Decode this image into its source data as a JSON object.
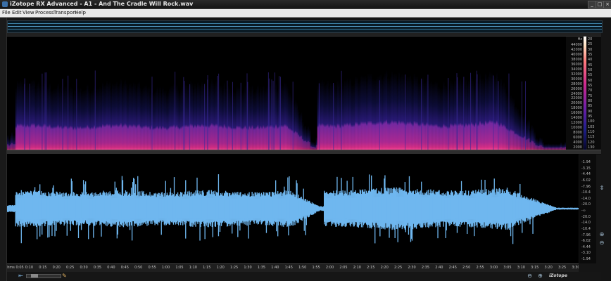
{
  "window": {
    "title": "iZotope RX Advanced - A1 - And The Cradle Will Rock.wav",
    "buttons": {
      "minimize": "_",
      "maximize": "□",
      "close": "×"
    }
  },
  "menu": [
    "File",
    "Edit",
    "View",
    "Process",
    "Transport",
    "Help"
  ],
  "spectrogram": {
    "freq_unit": "Hz",
    "freq_labels": [
      "44000",
      "42000",
      "40000",
      "38000",
      "36000",
      "34000",
      "32000",
      "30000",
      "28000",
      "26000",
      "24000",
      "22000",
      "20000",
      "18000",
      "16000",
      "14000",
      "12000",
      "10000",
      "8000",
      "6000",
      "4000",
      "2000"
    ],
    "db_labels": [
      "20",
      "25",
      "30",
      "35",
      "40",
      "45",
      "50",
      "55",
      "60",
      "65",
      "70",
      "75",
      "80",
      "85",
      "90",
      "95",
      "100",
      "105",
      "110",
      "115",
      "120",
      "130"
    ],
    "colors": {
      "background": "#000000",
      "low": "#1a1b7a",
      "mid": "#8a2aa8",
      "high": "#c42a8c",
      "peak": "#ff5aa8"
    }
  },
  "waveform": {
    "color": "#6fb7ef",
    "amp_labels": [
      "-1.94",
      "-3.15",
      "-4.44",
      "-6.02",
      "-7.96",
      "-10.4",
      "-14.0",
      "-20.0",
      "-∞",
      "-20.0",
      "-14.0",
      "-10.4",
      "-7.96",
      "-6.02",
      "-4.44",
      "-3.10",
      "-1.94"
    ]
  },
  "timeline": {
    "labels": [
      "hms 0:05",
      "0:10",
      "0:15",
      "0:20",
      "0:25",
      "0:30",
      "0:35",
      "0:40",
      "0:45",
      "0:50",
      "0:55",
      "1:00",
      "1:05",
      "1:10",
      "1:15",
      "1:20",
      "1:25",
      "1:30",
      "1:35",
      "1:40",
      "1:45",
      "1:50",
      "1:55",
      "2:00",
      "2:05",
      "2:10",
      "2:15",
      "2:20",
      "2:25",
      "2:30",
      "2:35",
      "2:40",
      "2:45",
      "2:50",
      "2:55",
      "3:00",
      "3:05",
      "3:10",
      "3:15",
      "3:20",
      "3:25",
      "3:30"
    ]
  },
  "footer": {
    "logo": "iZotope"
  },
  "icons": {
    "zoom_out_horizontal": "zoom-out-icon",
    "zoom_in_horizontal": "zoom-in-icon",
    "zoom_out_vertical": "magnify-minus-icon",
    "zoom_in_vertical": "magnify-plus-icon",
    "waveform_zoom": "amplitude-zoom-icon"
  }
}
